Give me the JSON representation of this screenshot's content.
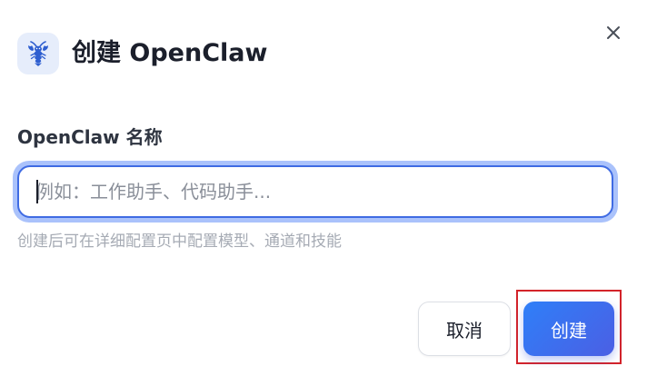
{
  "dialog": {
    "title": "创建 OpenClaw",
    "logo_icon": "lobster-icon",
    "close_icon": "close-icon",
    "field_label": "OpenClaw 名称",
    "input": {
      "value": "",
      "placeholder": "例如：工作助手、代码助手..."
    },
    "hint": "创建后可在详细配置页中配置模型、通道和技能",
    "cancel_label": "取消",
    "create_label": "创建"
  },
  "colors": {
    "accent": "#3f6be3",
    "primary_gradient_start": "#2f7ff8",
    "primary_gradient_end": "#4b5fe4",
    "highlight": "#d3232a",
    "logo_bg": "#e6edfb"
  }
}
